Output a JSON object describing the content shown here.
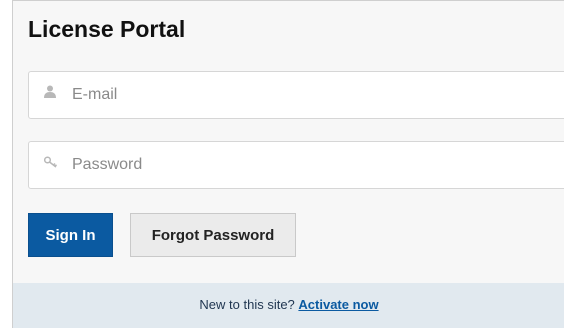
{
  "page": {
    "title": "License Portal"
  },
  "form": {
    "email": {
      "placeholder": "E-mail",
      "value": "",
      "icon": "user-icon"
    },
    "password": {
      "placeholder": "Password",
      "value": "",
      "icon": "key-icon"
    }
  },
  "buttons": {
    "sign_in": "Sign In",
    "forgot_password": "Forgot Password"
  },
  "footer": {
    "prompt": "New to this site?",
    "link": "Activate now"
  },
  "colors": {
    "primary": "#0b5aa1",
    "footer_bg": "#e1e9ef",
    "panel_bg": "#f7f7f7"
  }
}
